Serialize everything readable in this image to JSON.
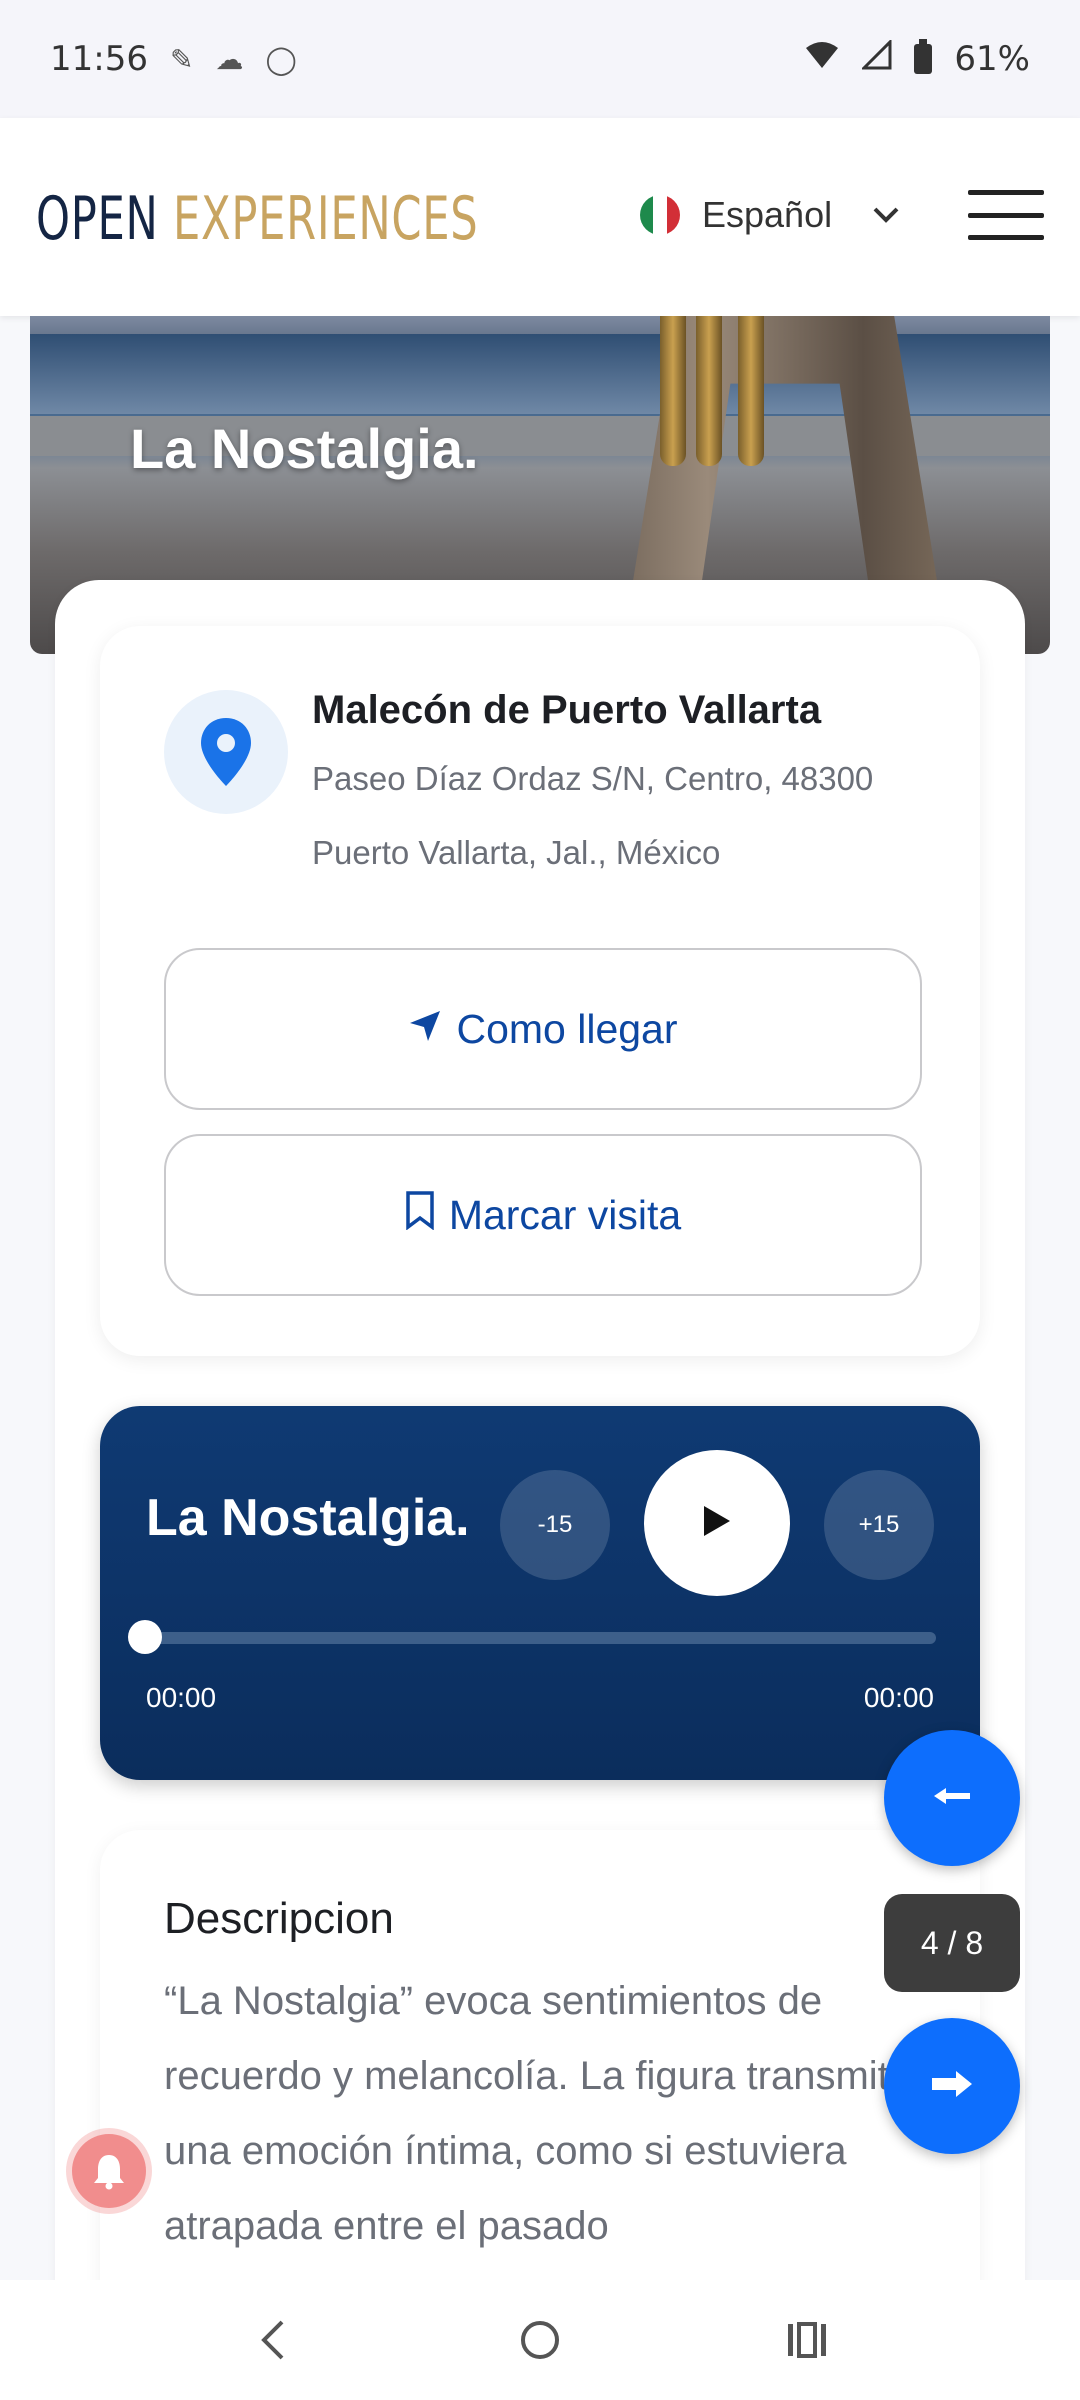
{
  "status_bar": {
    "time": "11:56",
    "battery": "61%",
    "icons": [
      "signal-notification-icon",
      "cloud-icon",
      "circle-app-icon",
      "wifi-icon",
      "cell-signal-icon",
      "battery-icon"
    ]
  },
  "header": {
    "logo_open": "OPEN",
    "logo_experiences": "EXPERIENCES",
    "language": "Español",
    "colors": {
      "logo_dark": "#142544",
      "logo_gold": "#c8a461"
    }
  },
  "hero": {
    "title": "La Nostalgia."
  },
  "location": {
    "name": "Malecón de Puerto Vallarta",
    "address_line1": "Paseo Díaz Ordaz S/N, Centro, 48300",
    "address_line2": "Puerto Vallarta, Jal., México",
    "directions_label": "Como llegar",
    "mark_visit_label": "Marcar visita",
    "accent_color": "#0d47a1"
  },
  "player": {
    "title": "La Nostalgia.",
    "skip_back": "-15",
    "skip_forward": "+15",
    "current_time": "00:00",
    "duration": "00:00",
    "progress": 0
  },
  "description": {
    "title": "Descripcion",
    "text": "“La Nostalgia” evoca sentimientos de recuerdo y melancolía. La figura transmite una emoción íntima, como si estuviera atrapada entre el pasado"
  },
  "pager": {
    "counter": "4 / 8"
  }
}
